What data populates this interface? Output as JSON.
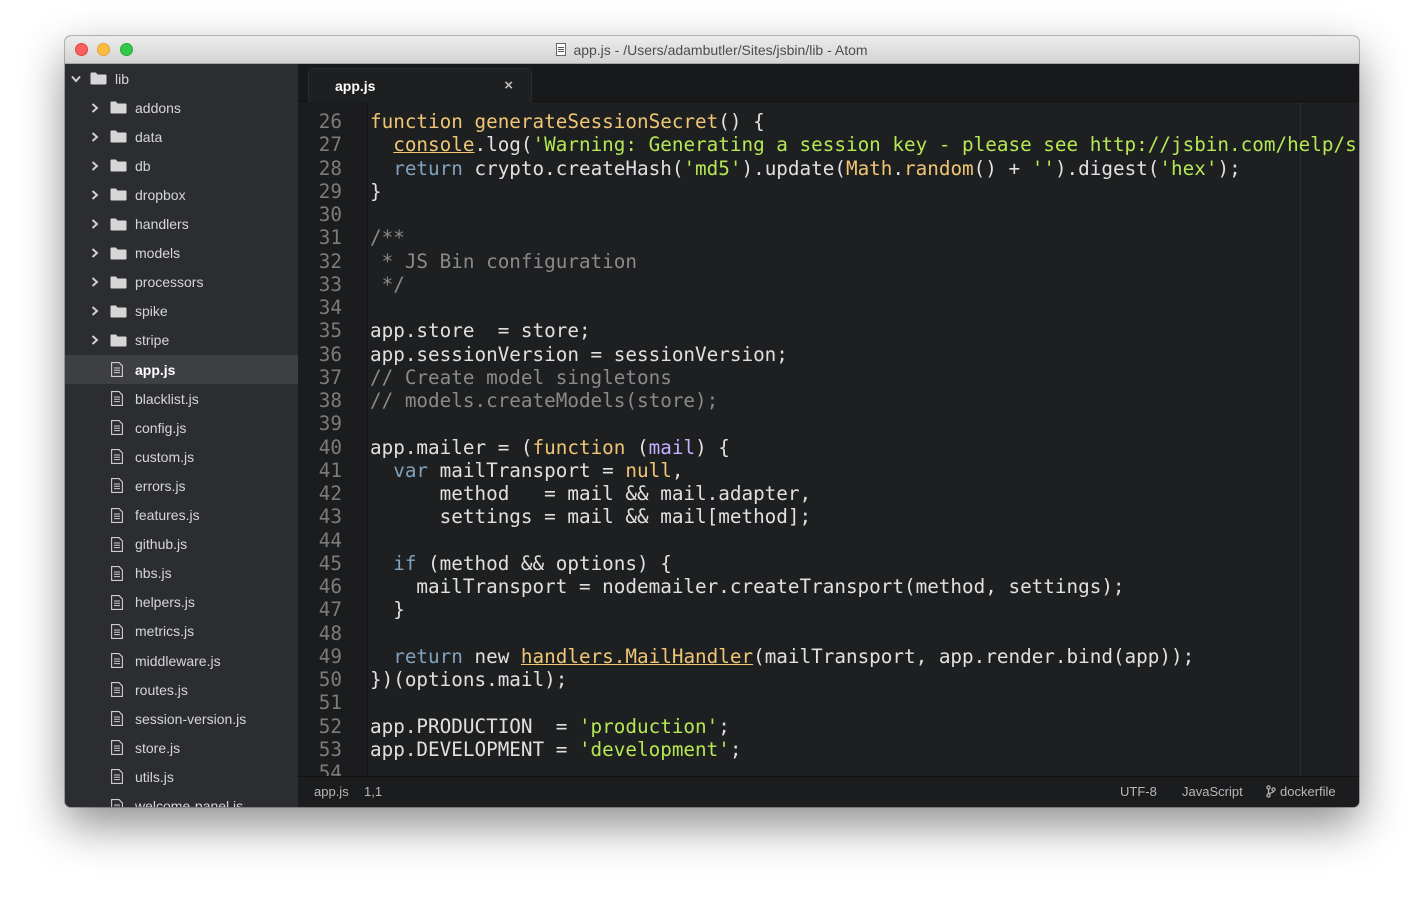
{
  "window": {
    "title": "app.js - /Users/adambutler/Sites/jsbin/lib - Atom"
  },
  "tree": {
    "root": "lib",
    "folders": [
      "addons",
      "data",
      "db",
      "dropbox",
      "handlers",
      "models",
      "processors",
      "spike",
      "stripe"
    ],
    "files": [
      "app.js",
      "blacklist.js",
      "config.js",
      "custom.js",
      "errors.js",
      "features.js",
      "github.js",
      "hbs.js",
      "helpers.js",
      "metrics.js",
      "middleware.js",
      "routes.js",
      "session-version.js",
      "store.js",
      "utils.js",
      "welcome-panel.js"
    ],
    "selected": "app.js"
  },
  "tab": {
    "label": "app.js",
    "close": "×"
  },
  "editor": {
    "first_line": 26,
    "lines": [
      [
        [
          "function ",
          "kw"
        ],
        [
          "generateSessionSecret",
          "fn"
        ],
        [
          "() {",
          "p"
        ]
      ],
      [
        [
          "  ",
          "p"
        ],
        [
          "console",
          "cu"
        ],
        [
          ".log(",
          "p"
        ],
        [
          "'Warning: Generating a session key - please see http://jsbin.com/help/s",
          "str"
        ]
      ],
      [
        [
          "  ",
          "p"
        ],
        [
          "return ",
          "ret"
        ],
        [
          "crypto.createHash(",
          "p"
        ],
        [
          "'md5'",
          "str"
        ],
        [
          ").update(",
          "p"
        ],
        [
          "Math",
          "cls"
        ],
        [
          ".",
          "p"
        ],
        [
          "random",
          "fn"
        ],
        [
          "() + ",
          "p"
        ],
        [
          "''",
          "str"
        ],
        [
          ").digest(",
          "p"
        ],
        [
          "'hex'",
          "str"
        ],
        [
          ");",
          "p"
        ]
      ],
      [
        [
          "}",
          "p"
        ]
      ],
      [
        [
          "",
          "p"
        ]
      ],
      [
        [
          "/**",
          "cm"
        ]
      ],
      [
        [
          " * JS Bin configuration",
          "cm"
        ]
      ],
      [
        [
          " */",
          "cm"
        ]
      ],
      [
        [
          "",
          "p"
        ]
      ],
      [
        [
          "app.store  = store;",
          "p"
        ]
      ],
      [
        [
          "app.sessionVersion = sessionVersion;",
          "p"
        ]
      ],
      [
        [
          "// Create model singletons",
          "cm"
        ]
      ],
      [
        [
          "// models.createModels(store);",
          "cm"
        ]
      ],
      [
        [
          "",
          "p"
        ]
      ],
      [
        [
          "app.mailer = (",
          "p"
        ],
        [
          "function ",
          "kw"
        ],
        [
          "(",
          "p"
        ],
        [
          "mail",
          "prm"
        ],
        [
          ") {",
          "p"
        ]
      ],
      [
        [
          "  ",
          "p"
        ],
        [
          "var ",
          "ret"
        ],
        [
          "mailTransport = ",
          "p"
        ],
        [
          "null",
          "kw"
        ],
        [
          ",",
          "p"
        ]
      ],
      [
        [
          "      method   = mail && mail.adapter,",
          "p"
        ]
      ],
      [
        [
          "      settings = mail && mail[method];",
          "p"
        ]
      ],
      [
        [
          "",
          "p"
        ]
      ],
      [
        [
          "  ",
          "p"
        ],
        [
          "if ",
          "ret"
        ],
        [
          "(method && options) {",
          "p"
        ]
      ],
      [
        [
          "    mailTransport = nodemailer.createTransport(method, settings);",
          "p"
        ]
      ],
      [
        [
          "  }",
          "p"
        ]
      ],
      [
        [
          "",
          "p"
        ]
      ],
      [
        [
          "  ",
          "p"
        ],
        [
          "return ",
          "ret"
        ],
        [
          "new ",
          "p"
        ],
        [
          "handlers.MailHandler",
          "cu"
        ],
        [
          "(mailTransport, app.render.bind(app));",
          "p"
        ]
      ],
      [
        [
          "})(options.mail);",
          "p"
        ]
      ],
      [
        [
          "",
          "p"
        ]
      ],
      [
        [
          "app.PRODUCTION  = ",
          "p"
        ],
        [
          "'production'",
          "str"
        ],
        [
          ";",
          "p"
        ]
      ],
      [
        [
          "app.DEVELOPMENT = ",
          "p"
        ],
        [
          "'development'",
          "str"
        ],
        [
          ";",
          "p"
        ]
      ],
      [
        [
          "",
          "p"
        ]
      ]
    ]
  },
  "status": {
    "file": "app.js",
    "cursor": "1,1",
    "encoding": "UTF-8",
    "grammar": "JavaScript",
    "branch": "dockerfile"
  },
  "colors": {
    "kw": "#f0c674",
    "fn": "#f0c674",
    "str": "#b5e853",
    "cm": "#8a8a8a",
    "ret": "#81a2be",
    "cls": "#f0c674",
    "prm": "#c7b0ff",
    "cu": "#f0c674",
    "p": "#e0e0e0"
  },
  "icons": {
    "folder": "folder-icon",
    "file": "file-icon",
    "chevron": "chevron-right-icon",
    "branch": "git-branch-icon"
  }
}
